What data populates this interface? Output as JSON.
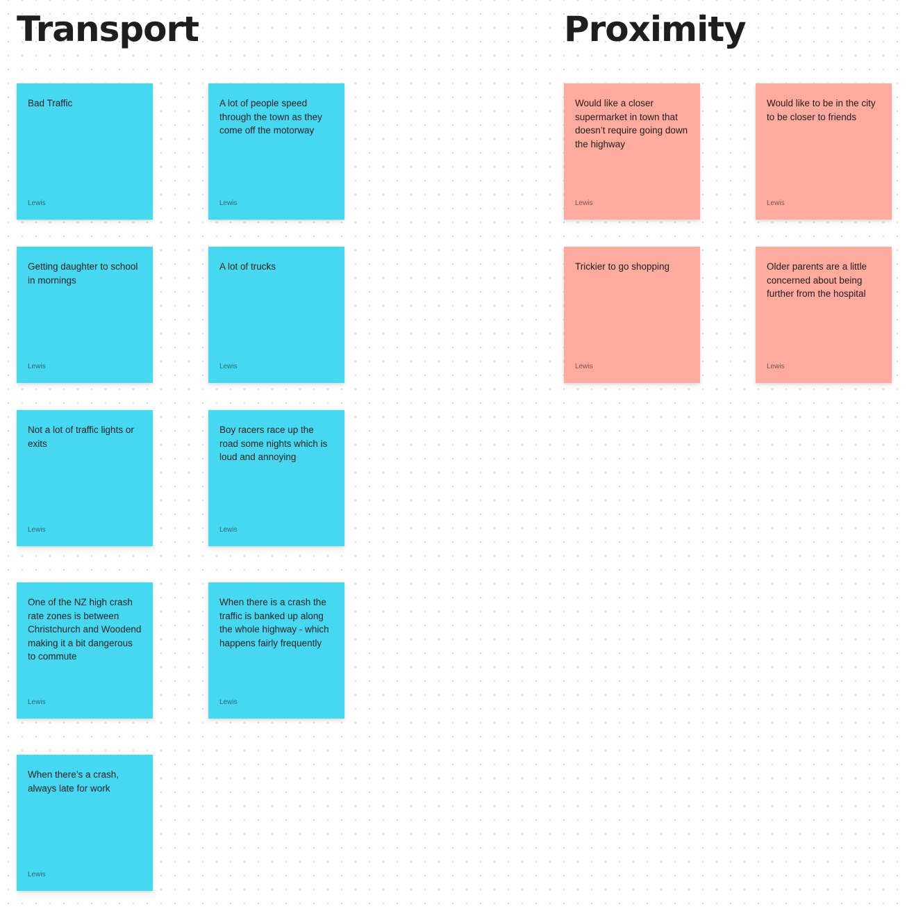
{
  "sections": [
    {
      "title": "Transport"
    },
    {
      "title": "Proximity"
    }
  ],
  "colors": {
    "transport_sticky": "#45d8f0",
    "proximity_sticky": "#ffaa9f",
    "title_text": "#1e1e1e",
    "canvas_dots": "#d6d6d6"
  },
  "transport_notes": [
    {
      "text": "Bad Traffic",
      "author": "Lewis"
    },
    {
      "text": "A lot of people speed through the town as they come off the motorway",
      "author": "Lewis"
    },
    {
      "text": "Getting daughter to school in mornings",
      "author": "Lewis"
    },
    {
      "text": "A lot of trucks",
      "author": "Lewis"
    },
    {
      "text": "Not a lot of traffic lights or exits",
      "author": "Lewis"
    },
    {
      "text": "Boy racers race up the road some nights which is loud and annoying",
      "author": "Lewis"
    },
    {
      "text": "One of the NZ high crash rate zones is between Christchurch and Woodend making it a bit dangerous to commute",
      "author": "Lewis"
    },
    {
      "text": "When there is a crash the traffic is banked up along the whole highway - which happens fairly frequently",
      "author": "Lewis"
    },
    {
      "text": "When there’s a crash, always late for work",
      "author": "Lewis"
    }
  ],
  "proximity_notes": [
    {
      "text": "Would like a closer supermarket in town that doesn’t require going down the highway",
      "author": "Lewis"
    },
    {
      "text": "Would like to be in the city to be closer to friends",
      "author": "Lewis"
    },
    {
      "text": "Trickier to go shopping",
      "author": "Lewis"
    },
    {
      "text": "Older parents are a little concerned about being further from the hospital",
      "author": "Lewis"
    }
  ]
}
